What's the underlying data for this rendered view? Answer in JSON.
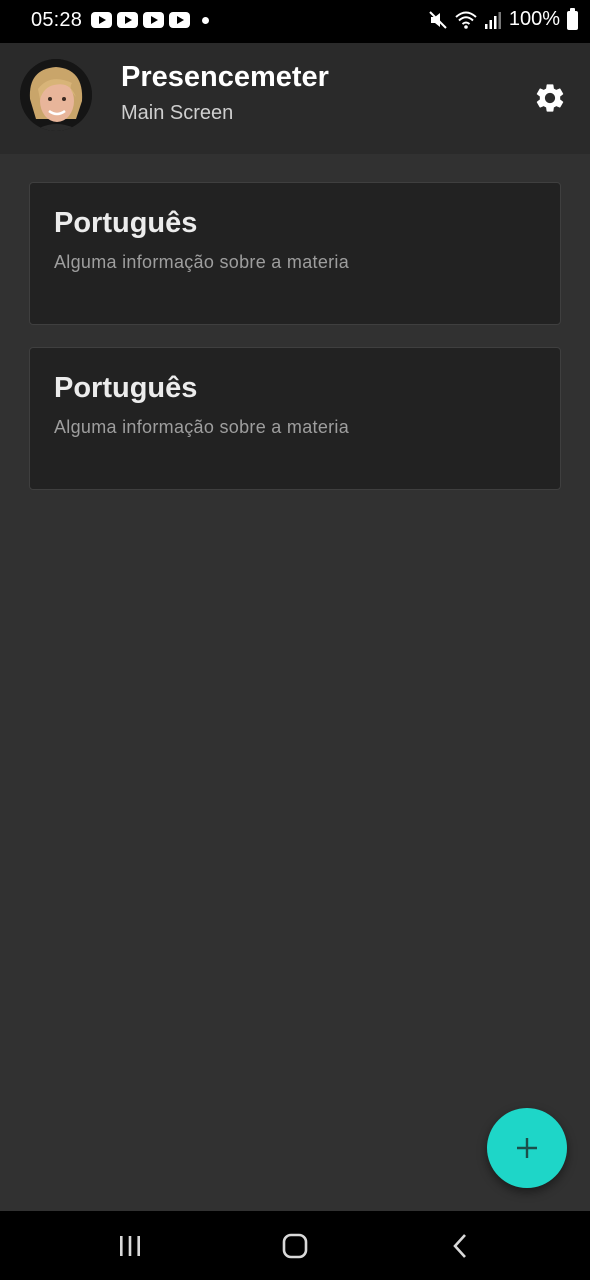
{
  "status_bar": {
    "time": "05:28",
    "notification_icons": [
      "youtube-icon",
      "youtube-icon",
      "youtube-icon",
      "youtube-icon"
    ],
    "battery_text": "100%"
  },
  "app_bar": {
    "title": "Presencemeter",
    "subtitle": "Main Screen"
  },
  "cards": [
    {
      "title": "Português",
      "description": "Alguma informação sobre a materia"
    },
    {
      "title": "Português",
      "description": "Alguma informação sobre a materia"
    }
  ],
  "fab": {
    "icon": "plus-icon",
    "color": "#1ed6c8"
  },
  "nav_bar": {
    "items": [
      "recent-apps-icon",
      "home-icon",
      "back-icon"
    ]
  },
  "colors": {
    "background": "#313131",
    "app_bar": "#2a2a2a",
    "card": "#222222",
    "accent": "#1ed6c8"
  }
}
